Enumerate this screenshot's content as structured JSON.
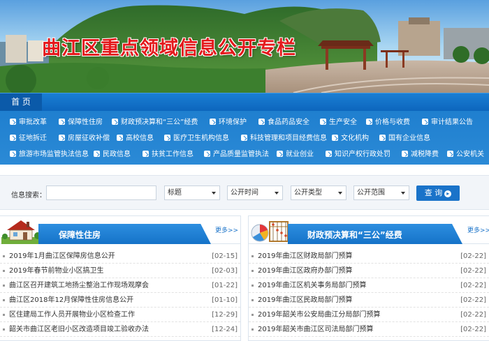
{
  "banner": {
    "title": "曲江区重点领域信息公开专栏"
  },
  "nav": {
    "home": "首 页"
  },
  "categories": [
    [
      "审批改革",
      "保障性住房",
      "财政预决算和“三公”经费",
      "环境保护",
      "食品药品安全",
      "生产安全",
      "价格与收费",
      "审计结果公告"
    ],
    [
      "征地拆迁",
      "房屋征收补偿",
      "高校信息",
      "医疗卫生机构信息",
      "科技管理和项目经费信息",
      "文化机构",
      "国有企业信息"
    ],
    [
      "旅游市场监管执法信息",
      "民政信息",
      "扶贫工作信息",
      "产品质量监管执法",
      "就业创业",
      "知识产权行政处罚",
      "减税降费",
      "公安机关"
    ]
  ],
  "search": {
    "label": "信息搜索：",
    "input_value": "",
    "selects": [
      "标题",
      "公开时间",
      "公开类型",
      "公开范围"
    ],
    "button": "查 询"
  },
  "panels": {
    "left": {
      "title": "保障性住房",
      "more": "更多>>",
      "items": [
        {
          "title": "2019年1月曲江区保障房信息公开",
          "date": "[02-15]"
        },
        {
          "title": "2019年春节前物业小区搞卫生",
          "date": "[02-03]"
        },
        {
          "title": "曲江区召开建筑工地扬尘整治工作现场观摩会",
          "date": "[01-22]"
        },
        {
          "title": "曲江区2018年12月保障性住房信息公开",
          "date": "[01-10]"
        },
        {
          "title": "区住建局工作人员开展物业小区检查工作",
          "date": "[12-29]"
        },
        {
          "title": "韶关市曲江区老旧小区改造项目竣工验收办法",
          "date": "[12-24]"
        }
      ]
    },
    "right": {
      "title": "财政预决算和“三公”经费",
      "more": "更多>>",
      "items": [
        {
          "title": "2019年曲江区财政局部门预算",
          "date": "[02-22]"
        },
        {
          "title": "2019年曲江区政府办部门预算",
          "date": "[02-22]"
        },
        {
          "title": "2019年曲江区机关事务局部门预算",
          "date": "[02-22]"
        },
        {
          "title": "2019年曲江区民政局部门预算",
          "date": "[02-22]"
        },
        {
          "title": "2019年韶关市公安局曲江分局部门预算",
          "date": "[02-22]"
        },
        {
          "title": "2019年韶关市曲江区司法局部门预算",
          "date": "[02-22]"
        }
      ]
    }
  },
  "colors": {
    "primary": "#1a73c9",
    "title_red": "#e4191c",
    "nav_blue": "#0d66bd"
  }
}
